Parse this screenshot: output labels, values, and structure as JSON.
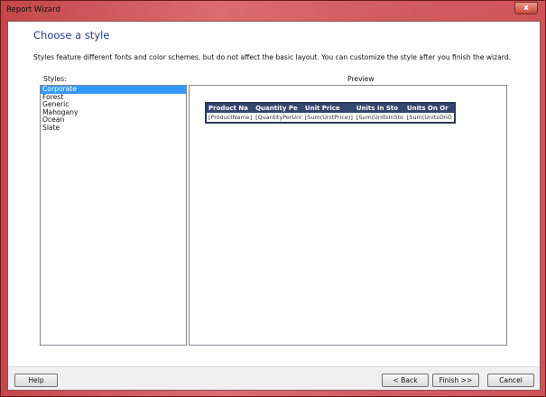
{
  "window": {
    "title": "Report Wizard",
    "close": "x"
  },
  "header": {
    "title": "Choose a style",
    "description": "Styles feature different fonts and color schemes, but do not affect the basic layout. You can customize the style after you finish the wizard."
  },
  "styles": {
    "label": "Styles:",
    "items": [
      "Corporate",
      "Forest",
      "Generic",
      "Mahogany",
      "Ocean",
      "Slate"
    ],
    "selected": "Corporate"
  },
  "preview": {
    "label": "Preview",
    "headers": [
      "Product Na",
      "Quantity Pe",
      "Unit Price",
      "Units In Sto",
      "Units On Or"
    ],
    "row": [
      "[ProductName]",
      "[QuantityPerUni",
      "[Sum(UnitPrice)]",
      "[Sum(UnitsInSto",
      "[Sum(UnitsOnO"
    ]
  },
  "buttons": {
    "help": "Help",
    "back": "< Back",
    "finish": "Finish >>",
    "cancel": "Cancel"
  },
  "colors": {
    "selection": "#3399ff",
    "table_header": "#34466e",
    "title": "#1e3c8c"
  }
}
